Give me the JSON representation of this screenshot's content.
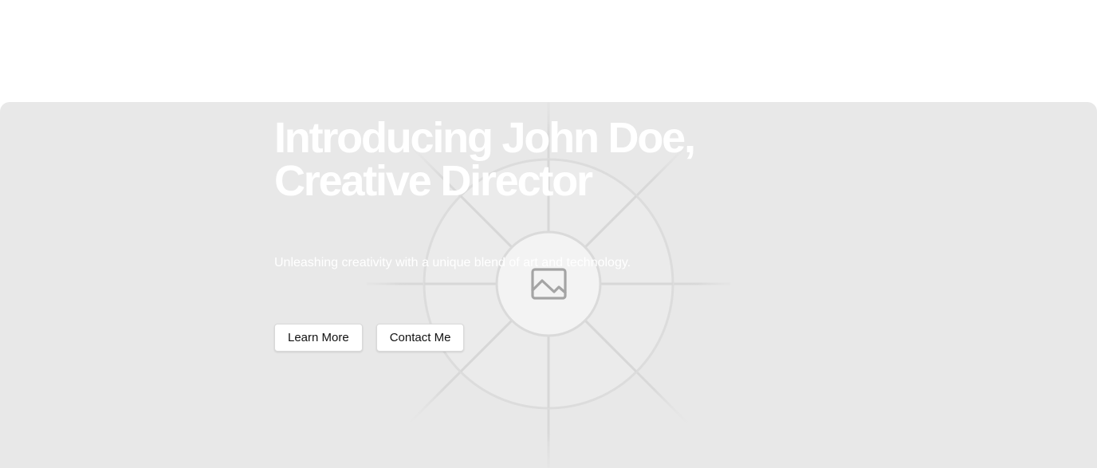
{
  "hero": {
    "title_line1": "Introducing John Doe,",
    "title_line2": "Creative Director",
    "subtitle": "Unleashing creativity with a unique blend of art and technology.",
    "primary_button": "Learn More",
    "secondary_button": "Contact Me",
    "background_color": "#e8e8e8",
    "image_icon": "image-placeholder-icon"
  }
}
